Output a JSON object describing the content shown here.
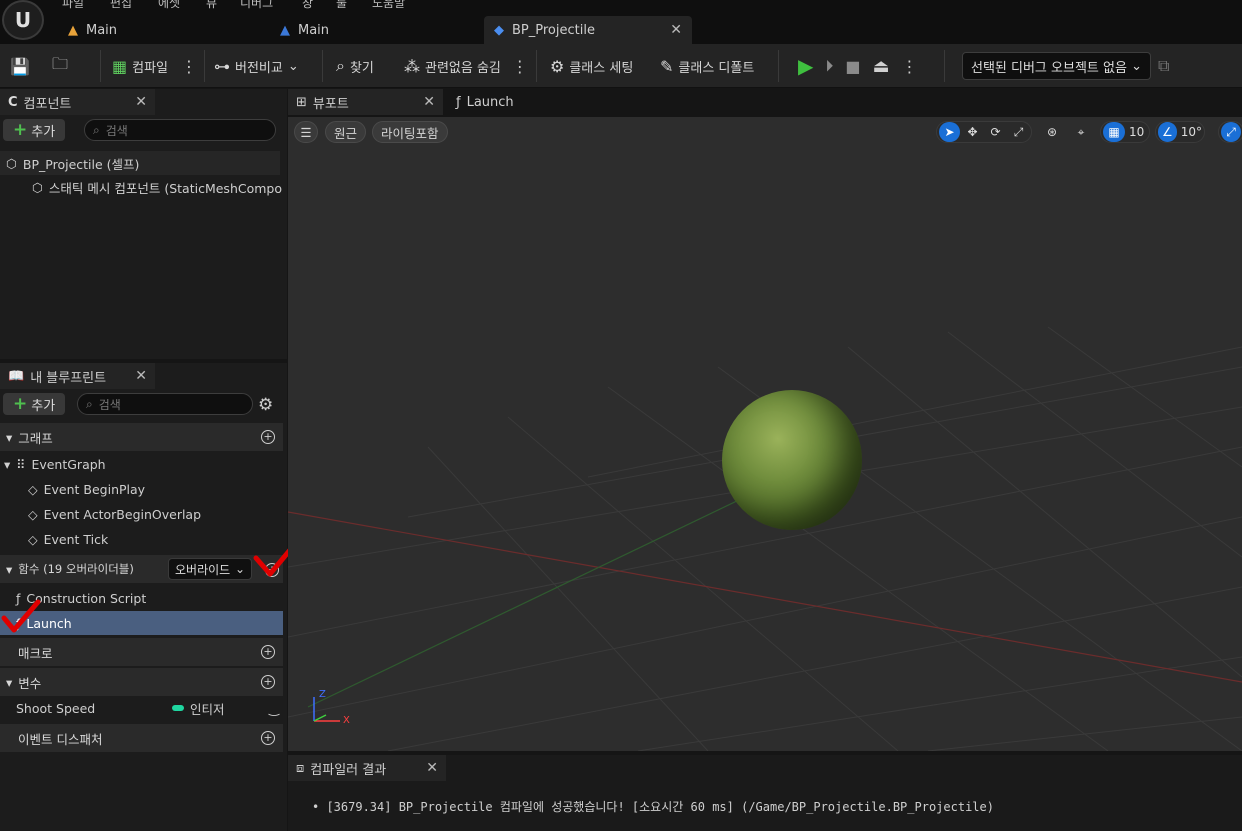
{
  "menu": [
    "파일",
    "편집",
    "에셋",
    "뷰",
    "디버그",
    "창",
    "툴",
    "도움말"
  ],
  "doc_tabs": [
    {
      "label": "Main"
    },
    {
      "label": "Main"
    },
    {
      "label": "BP_Projectile"
    }
  ],
  "toolbar": {
    "compile": "컴파일",
    "diff": "버전비교",
    "find": "찾기",
    "hide_unrelated": "관련없음 숨김",
    "class_settings": "클래스 세팅",
    "class_defaults": "클래스 디폴트",
    "debug_object": "선택된 디버그 오브젝트 없음"
  },
  "components": {
    "tab": "컴포넌트",
    "add": "추가",
    "search_placeholder": "검색",
    "items": [
      "BP_Projectile (셀프)",
      "스태틱 메시 컴포넌트 (StaticMeshCompo"
    ]
  },
  "my_blueprint": {
    "tab": "내 블루프린트",
    "add": "추가",
    "search_placeholder": "검색",
    "graphs": "그래프",
    "event_graph": "EventGraph",
    "events": [
      "Event BeginPlay",
      "Event ActorBeginOverlap",
      "Event Tick"
    ],
    "functions": "함수 (19 오버라이더블)",
    "override": "오버라이드",
    "function_items": [
      "Construction Script",
      "Launch"
    ],
    "macros": "매크로",
    "variables": "변수",
    "variable": {
      "name": "Shoot Speed",
      "type": "인티저",
      "type_color": "#1fd6a0"
    },
    "dispatchers": "이벤트 디스패처"
  },
  "viewport": {
    "tab": "뷰포트",
    "tab2": "Launch",
    "perspective": "원근",
    "lit": "라이팅포함",
    "grid_snap": "10",
    "rot_snap": "10°",
    "axis_z": "Z",
    "axis_x": "X"
  },
  "compiler": {
    "tab": "컴파일러 결과",
    "message": "[3679.34] BP_Projectile 컴파일에 성공했습니다! [소요시간 60 ms] (/Game/BP_Projectile.BP_Projectile)"
  },
  "colors": {
    "accent": "#1a6fd6",
    "play": "#3fbf3f",
    "selected_row": "#4a5f80",
    "annotation": "#e00000"
  }
}
